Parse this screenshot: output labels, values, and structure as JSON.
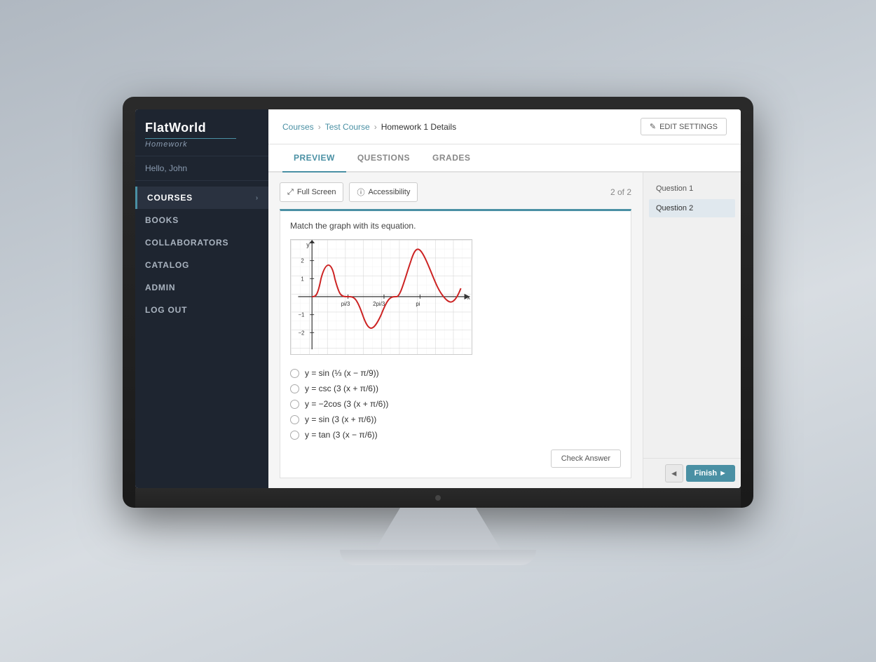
{
  "app": {
    "logo_title": "FlatWorld",
    "logo_subtitle": "Homework",
    "user_greeting": "Hello, John"
  },
  "sidebar": {
    "items": [
      {
        "label": "COURSES",
        "active": true,
        "has_chevron": true
      },
      {
        "label": "BOOKS",
        "active": false,
        "has_chevron": false
      },
      {
        "label": "COLLABORATORS",
        "active": false,
        "has_chevron": false
      },
      {
        "label": "CATALOG",
        "active": false,
        "has_chevron": false
      },
      {
        "label": "ADMIN",
        "active": false,
        "has_chevron": false
      },
      {
        "label": "LOG OUT",
        "active": false,
        "has_chevron": false
      }
    ]
  },
  "breadcrumb": {
    "items": [
      "Courses",
      "Test Course",
      "Homework 1 Details"
    ]
  },
  "edit_settings_label": "EDIT SETTINGS",
  "tabs": [
    {
      "label": "PREVIEW",
      "active": true
    },
    {
      "label": "QUESTIONS",
      "active": false
    },
    {
      "label": "GRADES",
      "active": false
    }
  ],
  "toolbar": {
    "fullscreen_label": "Full Screen",
    "accessibility_label": "Accessibility",
    "question_counter": "2 of 2"
  },
  "question": {
    "prompt": "Match the graph with its equation.",
    "choices": [
      "y = sin (⅓ (x − π/9))",
      "y = csc (3 (x + π/6))",
      "y = −2cos (3 (x + π/6))",
      "y = sin (3 (x + π/6))",
      "y = tan (3 (x − π/6))"
    ]
  },
  "question_nav": {
    "items": [
      "Question 1",
      "Question 2"
    ],
    "active_index": 1
  },
  "buttons": {
    "check_answer": "Check Answer",
    "prev_label": "◄",
    "finish_label": "Finish ►"
  }
}
